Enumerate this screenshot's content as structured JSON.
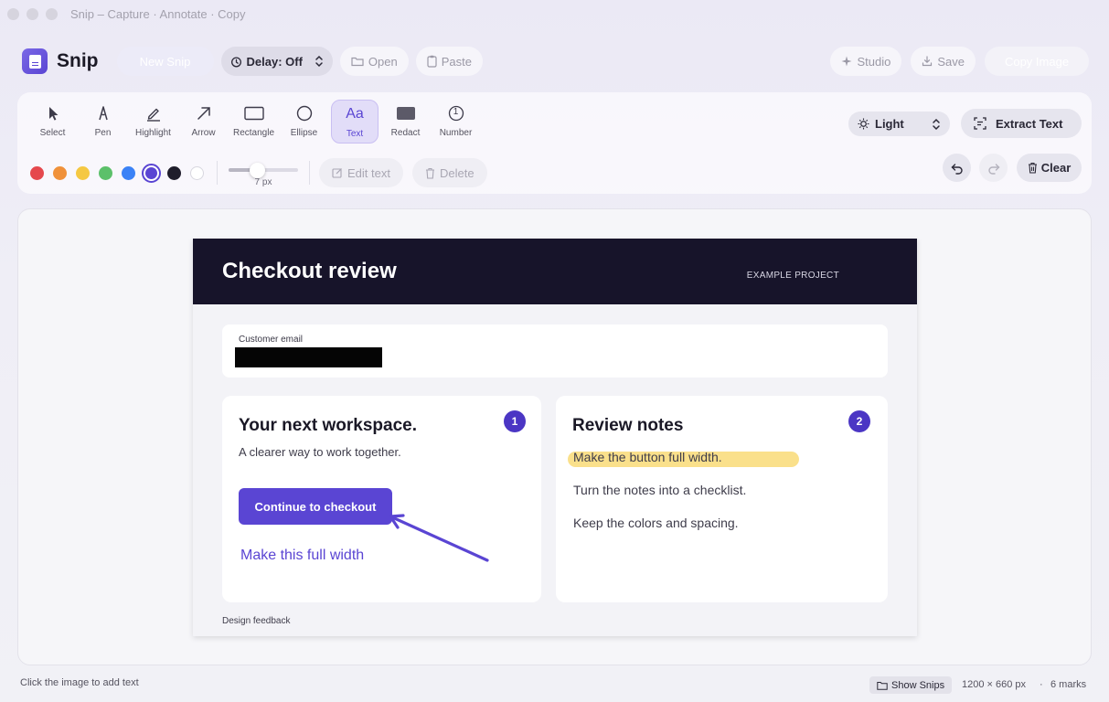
{
  "window": {
    "title": "Snip – Capture · Annotate · Copy"
  },
  "app": {
    "name": "Snip"
  },
  "toolbar": {
    "new_snip": "New Snip",
    "delay": "Delay: Off",
    "open": "Open",
    "paste": "Paste",
    "studio": "Studio",
    "save": "Save",
    "copy_image": "Copy Image"
  },
  "tools": [
    {
      "label": "Select",
      "icon": "cursor-icon"
    },
    {
      "label": "Pen",
      "icon": "pen-icon"
    },
    {
      "label": "Highlight",
      "icon": "highlighter-icon"
    },
    {
      "label": "Arrow",
      "icon": "arrow-icon"
    },
    {
      "label": "Rectangle",
      "icon": "rectangle-icon"
    },
    {
      "label": "Ellipse",
      "icon": "ellipse-icon"
    },
    {
      "label": "Text",
      "icon": "text-icon",
      "glyph": "Aa",
      "active": true
    },
    {
      "label": "Redact",
      "icon": "redact-icon"
    },
    {
      "label": "Number",
      "icon": "number-icon",
      "glyph": "1"
    }
  ],
  "colors": [
    "#e5484d",
    "#f0913a",
    "#f5c842",
    "#5cc06a",
    "#3b82f6",
    "#5a45d3",
    "#1f1d2b",
    "#ffffff"
  ],
  "selected_color": "#5a45d3",
  "stroke": {
    "value_label": "7 px",
    "level": 0.42
  },
  "actions": {
    "edit_text": "Edit text",
    "delete": "Delete",
    "clear": "Clear",
    "extract_text": "Extract Text"
  },
  "theme": {
    "selected": "Light"
  },
  "screenshot": {
    "title": "Checkout review",
    "project": "EXAMPLE PROJECT",
    "email_label": "Customer email",
    "left_card": {
      "title": "Your next workspace.",
      "subtitle": "A clearer way to work together.",
      "cta": "Continue to checkout",
      "badge": "1",
      "annotation": "Make this full width"
    },
    "right_card": {
      "title": "Review notes",
      "badge": "2",
      "notes": [
        "Make the button full width.",
        "Turn the notes into a checklist.",
        "Keep the colors and spacing."
      ]
    },
    "footer": "Design feedback"
  },
  "status": {
    "hint": "Click the image to add text",
    "show_snips": "Show Snips",
    "dimensions": "1200 × 660 px",
    "separator": "·",
    "marks": "6 marks"
  }
}
